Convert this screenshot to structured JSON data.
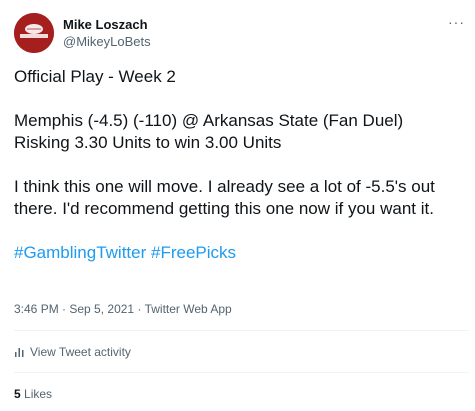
{
  "author": {
    "display_name": "Mike Loszach",
    "handle": "@MikeyLoBets",
    "avatar_text": "MIKEYLOBETS.COM"
  },
  "more_label": "···",
  "tweet": {
    "line1": "Official Play - Week 2",
    "line2": "Memphis (-4.5) (-110) @ Arkansas State (Fan Duel)",
    "line3": "Risking 3.30 Units to win 3.00 Units",
    "line4": "I think this one will move. I already see a lot of -5.5's out there. I'd recommend getting this one now if you want it.",
    "hashtags": [
      "#GamblingTwitter",
      "#FreePicks"
    ]
  },
  "meta": {
    "time": "3:46 PM",
    "separator": " · ",
    "date": "Sep 5, 2021",
    "source": "Twitter Web App"
  },
  "activity": {
    "label": "View Tweet activity",
    "icon": "bar-chart-icon"
  },
  "likes": {
    "count": "5",
    "label": "Likes"
  },
  "colors": {
    "text": "#0f1419",
    "secondary": "#536471",
    "link": "#1d9bf0",
    "avatar_bg": "#a61f1f"
  }
}
